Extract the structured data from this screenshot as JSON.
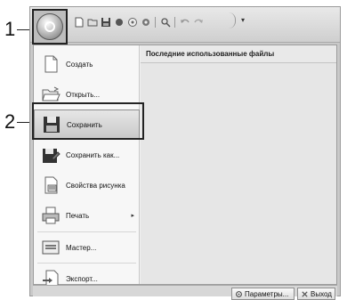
{
  "callouts": {
    "one": "1",
    "two": "2"
  },
  "qat": {
    "items": [
      "new-icon",
      "open-icon",
      "save-icon",
      "record-icon",
      "pan-icon",
      "zoom-icon",
      "undo-icon",
      "redo-icon"
    ],
    "customize_glyph": "▾"
  },
  "menu": {
    "items": [
      {
        "label": "Создать",
        "icon": "new-document-icon"
      },
      {
        "label": "Открыть...",
        "icon": "open-folder-icon"
      },
      {
        "label": "Сохранить",
        "icon": "save-icon"
      },
      {
        "label": "Сохранить как...",
        "icon": "save-as-icon"
      },
      {
        "label": "Свойства рисунка",
        "icon": "properties-icon"
      },
      {
        "label": "Печать",
        "icon": "printer-icon",
        "submenu_arrow": "▸"
      },
      {
        "label": "Мастер...",
        "icon": "wizard-icon"
      },
      {
        "label": "Экспорт...",
        "icon": "export-icon"
      }
    ],
    "recent_header": "Последние использованные файлы"
  },
  "footer": {
    "options_label": "Параметры...",
    "exit_label": "Выход"
  }
}
